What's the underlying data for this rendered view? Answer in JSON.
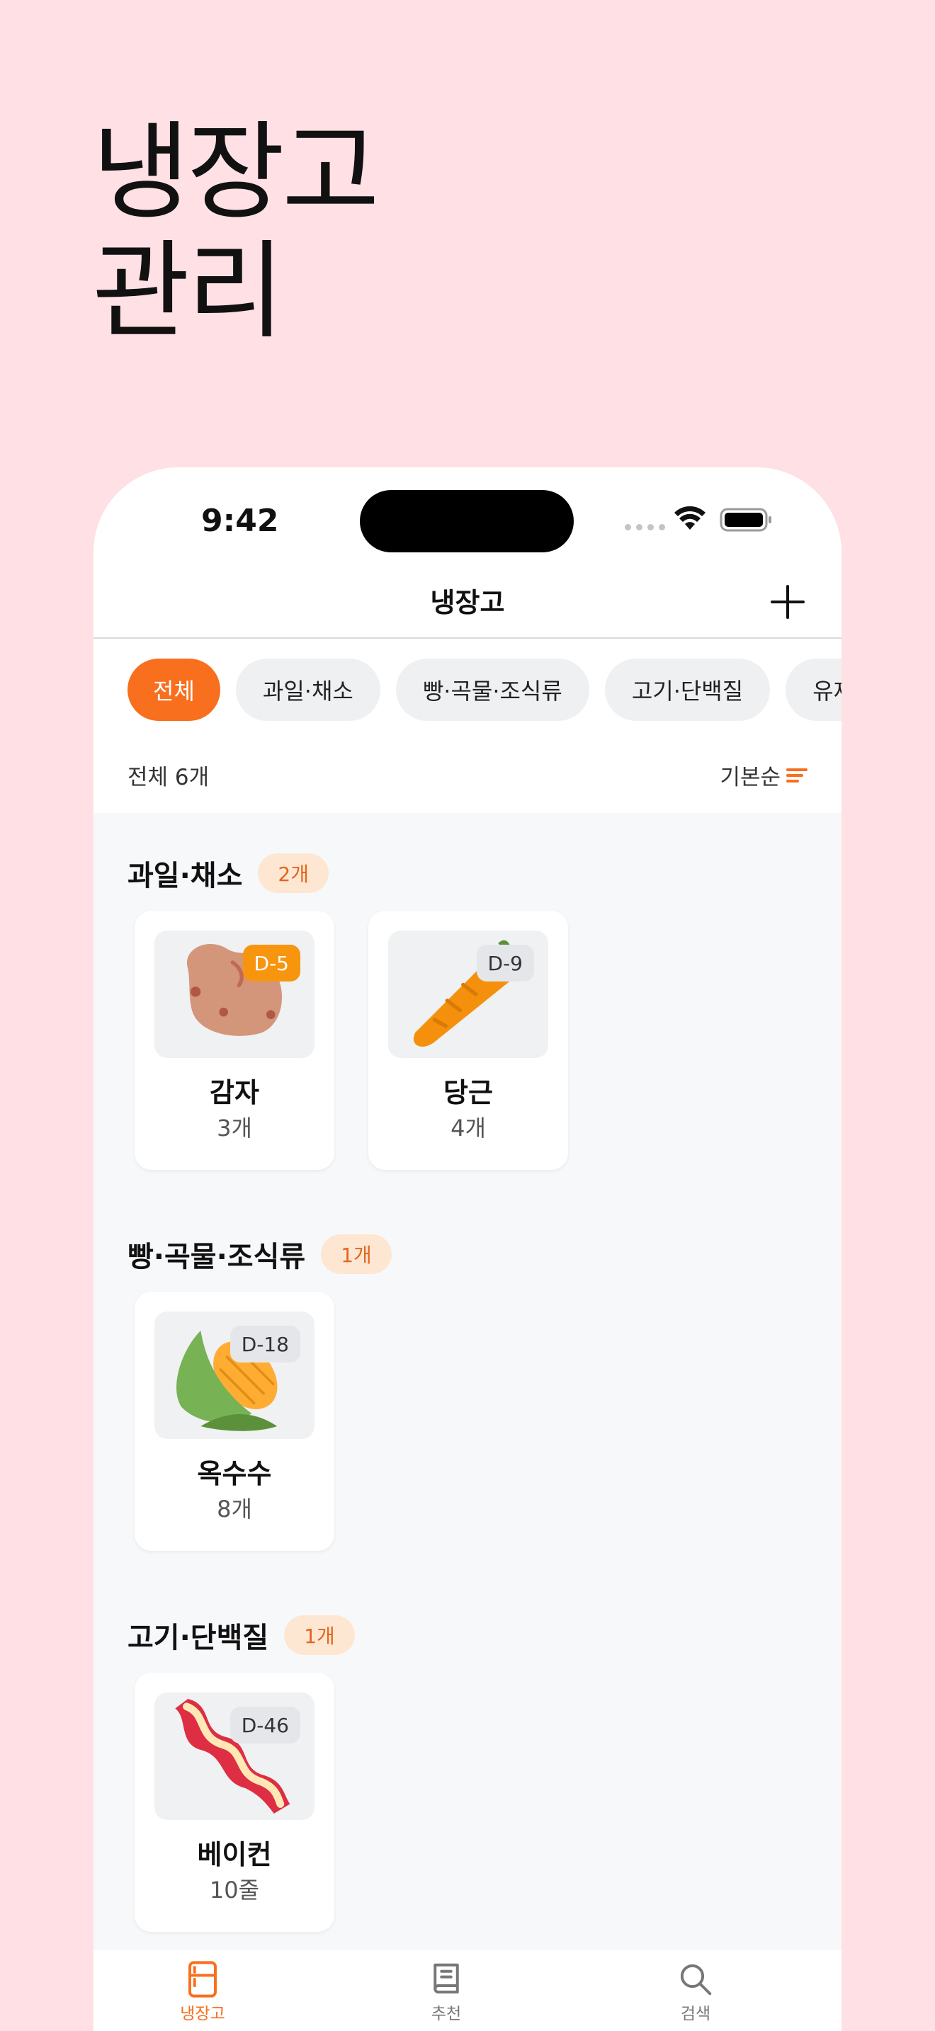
{
  "hero": {
    "line1": "냉장고",
    "line2": "관리"
  },
  "status_bar": {
    "time": "9:42"
  },
  "nav": {
    "title": "냉장고"
  },
  "chips": [
    {
      "label": "전체",
      "active": true
    },
    {
      "label": "과일·채소",
      "active": false
    },
    {
      "label": "빵·곡물·조식류",
      "active": false
    },
    {
      "label": "고기·단백질",
      "active": false
    },
    {
      "label": "유제",
      "active": false
    }
  ],
  "summary": {
    "count_text": "전체 6개",
    "sort_label": "기본순"
  },
  "sections": [
    {
      "title": "과일·채소",
      "badge": "2개",
      "items": [
        {
          "name": "감자",
          "qty": "3개",
          "dday": "D-5",
          "urgent": true,
          "icon": "potato-icon"
        },
        {
          "name": "당근",
          "qty": "4개",
          "dday": "D-9",
          "urgent": false,
          "icon": "carrot-icon"
        }
      ]
    },
    {
      "title": "빵·곡물·조식류",
      "badge": "1개",
      "items": [
        {
          "name": "옥수수",
          "qty": "8개",
          "dday": "D-18",
          "urgent": false,
          "icon": "corn-icon"
        }
      ]
    },
    {
      "title": "고기·단백질",
      "badge": "1개",
      "items": [
        {
          "name": "베이컨",
          "qty": "10줄",
          "dday": "D-46",
          "urgent": false,
          "icon": "bacon-icon"
        }
      ]
    }
  ],
  "tabbar": [
    {
      "label": "냉장고",
      "icon": "fridge-icon",
      "active": true
    },
    {
      "label": "추천",
      "icon": "book-icon",
      "active": false
    },
    {
      "label": "검색",
      "icon": "search-icon",
      "active": false
    }
  ],
  "colors": {
    "accent": "#F86F1E",
    "urgent": "#F7950F",
    "background": "#FFE0E4"
  }
}
